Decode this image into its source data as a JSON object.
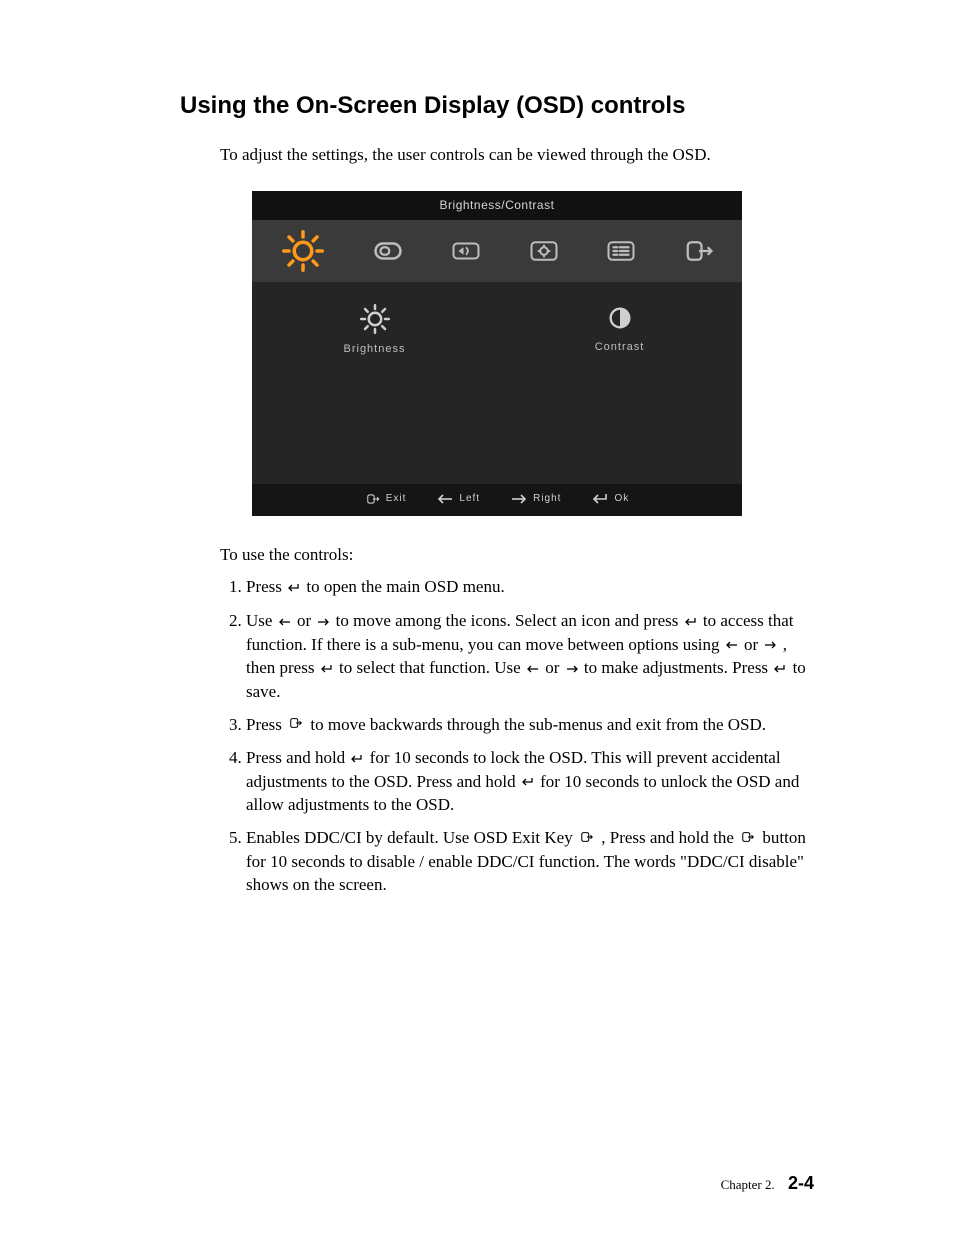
{
  "heading": "Using the On-Screen Display (OSD) controls",
  "intro": "To adjust the settings, the user controls can be viewed through the OSD.",
  "osd": {
    "title": "Brightness/Contrast",
    "options": {
      "brightness": "Brightness",
      "contrast": "Contrast"
    },
    "footer": {
      "exit": "Exit",
      "left": "Left",
      "right": "Right",
      "ok": "Ok"
    }
  },
  "howto_label": "To use the controls:",
  "steps": {
    "s1a": "Press  ",
    "s1b": "  to open the main OSD menu.",
    "s2a": "Use  ",
    "s2b": " or ",
    "s2c": "  to move among the icons. Select an icon and press  ",
    "s2d": "  to access that function. If there is a sub-menu, you can move between options using ",
    "s2e": " or ",
    "s2f": " , then press  ",
    "s2g": "  to select that function. Use  ",
    "s2h": " or ",
    "s2i": "  to make adjustments. Press  ",
    "s2j": "  to save.",
    "s3a": "Press  ",
    "s3b": "  to move backwards through the sub-menus and exit from the OSD.",
    "s4a": "Press and hold   ",
    "s4b": "  for 10 seconds to lock the OSD. This will prevent accidental adjustments to the OSD. Press and hold  ",
    "s4c": "  for 10  seconds to unlock the OSD and allow adjustments to the OSD.",
    "s5a": "Enables DDC/CI by default. Use OSD Exit Key ",
    "s5b": " , Press and hold the ",
    "s5c": " button for 10 seconds to disable / enable DDC/CI function. The words \"DDC/CI disable\" shows on the screen."
  },
  "footer": {
    "chapter": "Chapter 2.",
    "page": "2-4"
  }
}
